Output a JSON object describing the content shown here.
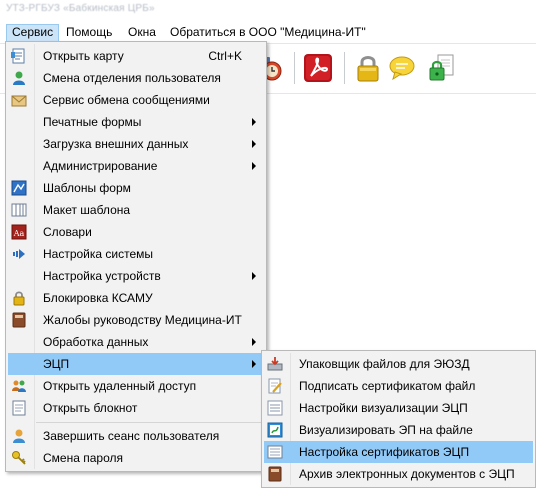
{
  "window": {
    "title": "УТЗ-РГБУЗ «Бабкинская ЦРБ»"
  },
  "menubar": [
    {
      "label": "Сервис",
      "active": true
    },
    {
      "label": "Помощь"
    },
    {
      "label": "Окна"
    },
    {
      "label": "Обратиться в ООО \"Медицина-ИТ\""
    }
  ],
  "toolbar": [
    {
      "icon": "clock-icon"
    },
    {
      "icon": "acrobat-icon"
    },
    {
      "icon": "padlock-icon"
    },
    {
      "icon": "speech-bubble-icon"
    },
    {
      "icon": "secure-document-icon"
    }
  ],
  "service_menu": {
    "items": [
      {
        "label": "Открыть карту",
        "shortcut": "Ctrl+K",
        "icon": "open-card-icon"
      },
      {
        "label": "Смена отделения пользователя",
        "icon": "change-department-icon"
      },
      {
        "label": "Сервис обмена сообщениями",
        "icon": "message-envelope-icon"
      },
      {
        "label": "Печатные формы",
        "submenu": true
      },
      {
        "label": "Загрузка внешних данных",
        "submenu": true
      },
      {
        "label": "Администрирование",
        "submenu": true
      },
      {
        "label": "Шаблоны форм",
        "icon": "form-templates-icon"
      },
      {
        "label": "Макет шаблона",
        "icon": "template-layout-icon"
      },
      {
        "label": "Словари",
        "icon": "dictionary-icon"
      },
      {
        "label": "Настройка системы",
        "icon": "system-settings-icon"
      },
      {
        "label": "Настройка устройств",
        "submenu": true
      },
      {
        "label": "Блокировка КСАМУ",
        "icon": "lock-icon"
      },
      {
        "label": "Жалобы руководству Медицина-ИТ",
        "icon": "complaint-book-icon"
      },
      {
        "label": "Обработка данных",
        "submenu": true
      },
      {
        "label": "ЭЦП",
        "submenu": true,
        "highlighted": true
      },
      {
        "label": "Открыть удаленный доступ",
        "icon": "remote-access-icon"
      },
      {
        "label": "Открыть блокнот",
        "icon": "notepad-icon"
      },
      {
        "label": "Завершить сеанс пользователя",
        "icon": "end-session-icon"
      },
      {
        "label": "Смена пароля",
        "icon": "key-icon"
      }
    ]
  },
  "ecp_submenu": {
    "items": [
      {
        "label": "Упаковщик файлов для ЭЮЗД",
        "icon": "packer-icon"
      },
      {
        "label": "Подписать сертификатом файл",
        "icon": "sign-file-icon"
      },
      {
        "label": "Настройки визуализации ЭЦП",
        "icon": "visualization-settings-icon"
      },
      {
        "label": "Визуализировать ЭП на файле",
        "icon": "visualize-signature-icon"
      },
      {
        "label": "Настройка сертификатов ЭЦП",
        "icon": "certificate-settings-icon",
        "highlighted": true
      },
      {
        "label": "Архив электронных документов с ЭЦП",
        "icon": "archive-book-icon"
      }
    ]
  },
  "colors": {
    "highlight": "#91c9f7",
    "menu_bg": "#f2f2f2",
    "menubar_active": "#cce4f7"
  }
}
